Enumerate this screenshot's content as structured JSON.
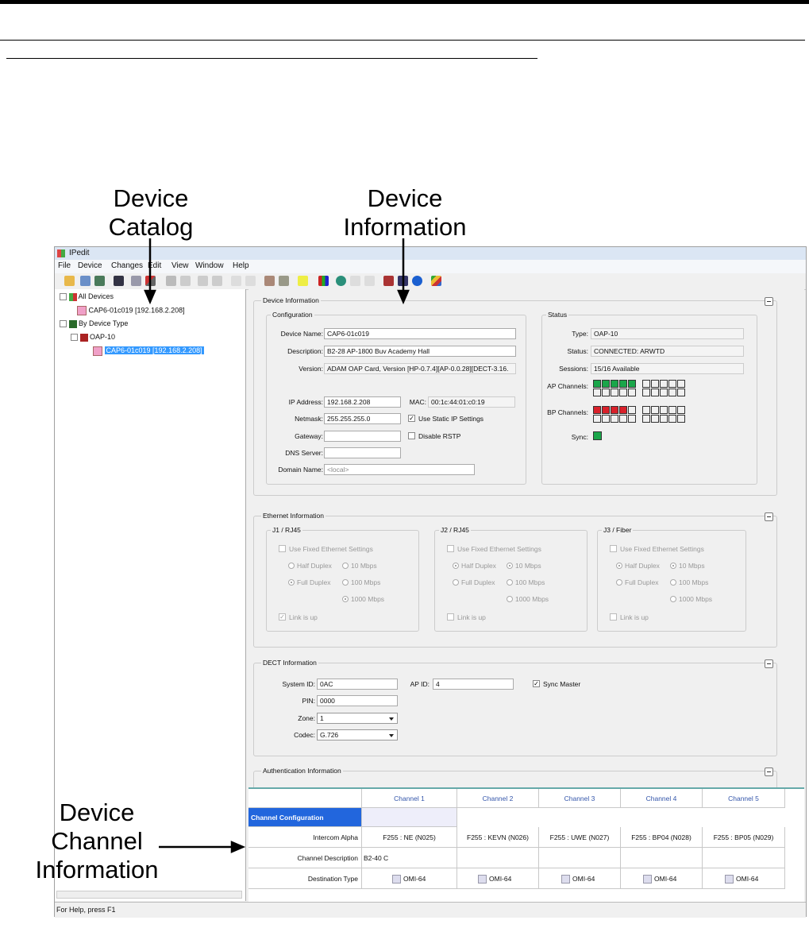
{
  "callouts": {
    "catalog": [
      "Device",
      "Catalog"
    ],
    "information": [
      "Device",
      "Information"
    ],
    "channel": [
      "Device",
      "Channel",
      "Information"
    ]
  },
  "window": {
    "title": "IPedit",
    "menu": [
      "File",
      "Device",
      "Changes",
      "Edit",
      "View",
      "Window",
      "Help"
    ]
  },
  "tree": {
    "all_devices": "All Devices",
    "all_device_item": "CAP6-01c019 [192.168.2.208]",
    "by_type": "By Device Type",
    "type_node": "OAP-10",
    "type_item": "CAP6-01c019 [192.168.2.208]"
  },
  "device_info": {
    "title": "Device Information",
    "configuration": {
      "title": "Configuration",
      "device_name_label": "Device Name:",
      "device_name": "CAP6-01c019",
      "description_label": "Description:",
      "description": "B2-28 AP-1800 Buv Academy Hall",
      "version_label": "Version:",
      "version": "ADAM OAP Card, Version [HP-0.7.4][AP-0.0.28][DECT-3.16.",
      "ip_label": "IP Address:",
      "ip": "192.168.2.208",
      "mac_label": "MAC:",
      "mac": "00:1c:44:01:c0:19",
      "netmask_label": "Netmask:",
      "netmask": "255.255.255.0",
      "static_ip_label": "Use Static IP Settings",
      "gateway_label": "Gateway:",
      "gateway": "",
      "rstp_label": "Disable RSTP",
      "dns_label": "DNS Server:",
      "dns": "",
      "domain_label": "Domain Name:",
      "domain_placeholder": "<local>"
    },
    "status": {
      "title": "Status",
      "type_label": "Type:",
      "type": "OAP-10",
      "status_label": "Status:",
      "status": "CONNECTED: ARWTD",
      "sessions_label": "Sessions:",
      "sessions": "15/16 Available",
      "ap_label": "AP Channels:",
      "bp_label": "BP Channels:",
      "sync_label": "Sync:",
      "ap_active": 5,
      "bp_active": 4,
      "colors": {
        "ap": "#1aa64a",
        "bp": "#d9202a",
        "sync": "#1aa64a"
      }
    }
  },
  "ethernet": {
    "title": "Ethernet Information",
    "ports": [
      {
        "name": "J1 / RJ45",
        "fixed": "Use Fixed Ethernet Settings",
        "half": "Half Duplex",
        "full": "Full Duplex",
        "s10": "10 Mbps",
        "s100": "100 Mbps",
        "s1000": "1000 Mbps",
        "link": "Link is up"
      },
      {
        "name": "J2 / RJ45",
        "fixed": "Use Fixed Ethernet Settings",
        "half": "Half Duplex",
        "full": "Full Duplex",
        "s10": "10 Mbps",
        "s100": "100 Mbps",
        "s1000": "1000 Mbps",
        "link": "Link is up"
      },
      {
        "name": "J3 / Fiber",
        "fixed": "Use Fixed Ethernet Settings",
        "half": "Half Duplex",
        "full": "Full Duplex",
        "s10": "10 Mbps",
        "s100": "100 Mbps",
        "s1000": "1000 Mbps",
        "link": "Link is up"
      }
    ]
  },
  "dect": {
    "title": "DECT Information",
    "system_id_label": "System ID:",
    "system_id": "0AC",
    "ap_id_label": "AP ID:",
    "ap_id": "4",
    "sync_master_label": "Sync Master",
    "pin_label": "PIN:",
    "pin": "0000",
    "zone_label": "Zone:",
    "zone": "1",
    "codec_label": "Codec:",
    "codec": "G.726"
  },
  "auth": {
    "title": "Authentication Information"
  },
  "channels": {
    "header": "Channel Configuration",
    "columns": [
      "Channel 1",
      "Channel 2",
      "Channel 3",
      "Channel 4",
      "Channel 5"
    ],
    "rows": [
      {
        "label": "Intercom Alpha",
        "values": [
          "F255 : NE (N025)",
          "F255 : KEVN (N026)",
          "F255 : UWE (N027)",
          "F255 : BP04 (N028)",
          "F255 : BP05 (N029)"
        ]
      },
      {
        "label": "Channel Description",
        "values": [
          "B2-40 C",
          "",
          "",
          "",
          ""
        ]
      },
      {
        "label": "Destination Type",
        "values": [
          "OMI-64",
          "OMI-64",
          "OMI-64",
          "OMI-64",
          "OMI-64"
        ]
      }
    ]
  },
  "statusbar": "For Help, press F1"
}
